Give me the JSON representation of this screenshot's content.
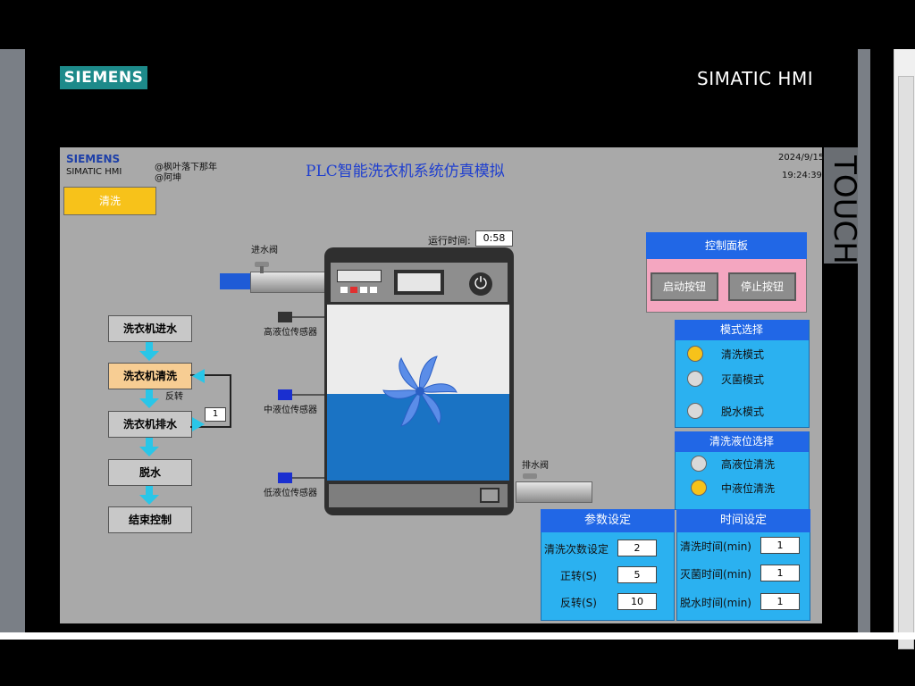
{
  "header": {
    "brand": "SIEMENS",
    "product": "SIMATIC HMI"
  },
  "touch_label": "TOUCH",
  "screen": {
    "logo": {
      "brand": "SIEMENS",
      "product": "SIMATIC HMI"
    },
    "credits": [
      "@枫叶落下那年",
      "@阿坤"
    ],
    "title": "PLC智能洗衣机系统仿真模拟",
    "date": "2024/9/15",
    "time": "19:24:39",
    "status_button": "清洗",
    "run_time_label": "运行时间:",
    "run_time_value": "0:58",
    "inlet_valve": "进水阀",
    "drain_valve": "排水阀",
    "sensors": {
      "high": "高液位传感器",
      "mid": "中液位传感器",
      "low": "低液位传感器"
    },
    "process": {
      "steps": [
        "洗衣机进水",
        "洗衣机清洗",
        "洗衣机排水",
        "脱水",
        "结束控制"
      ],
      "reverse_label": "反转",
      "loop_count": "1"
    },
    "control_panel": {
      "title": "控制面板",
      "start": "启动按钮",
      "stop": "停止按钮"
    },
    "mode_select": {
      "title": "模式选择",
      "options": [
        {
          "label": "清洗模式",
          "selected": true
        },
        {
          "label": "灭菌模式",
          "selected": false
        },
        {
          "label": "脱水模式",
          "selected": false
        }
      ]
    },
    "level_select": {
      "title": "清洗液位选择",
      "options": [
        {
          "label": "高液位清洗",
          "selected": false
        },
        {
          "label": "中液位清洗",
          "selected": true
        }
      ]
    },
    "params": {
      "title": "参数设定",
      "rows": [
        {
          "label": "清洗次数设定",
          "value": "2"
        },
        {
          "label": "正转(S)",
          "value": "5"
        },
        {
          "label": "反转(S)",
          "value": "10"
        }
      ]
    },
    "time_settings": {
      "title": "时间设定",
      "rows": [
        {
          "label": "清洗时间(min)",
          "value": "1"
        },
        {
          "label": "灭菌时间(min)",
          "value": "1"
        },
        {
          "label": "脱水时间(min)",
          "value": "1"
        }
      ]
    }
  },
  "colors": {
    "accent": "#2167e6",
    "panel": "#2bb1f0",
    "water": "#1a73c4",
    "active_step": "#f7cd93",
    "status": "#f7c21a"
  }
}
